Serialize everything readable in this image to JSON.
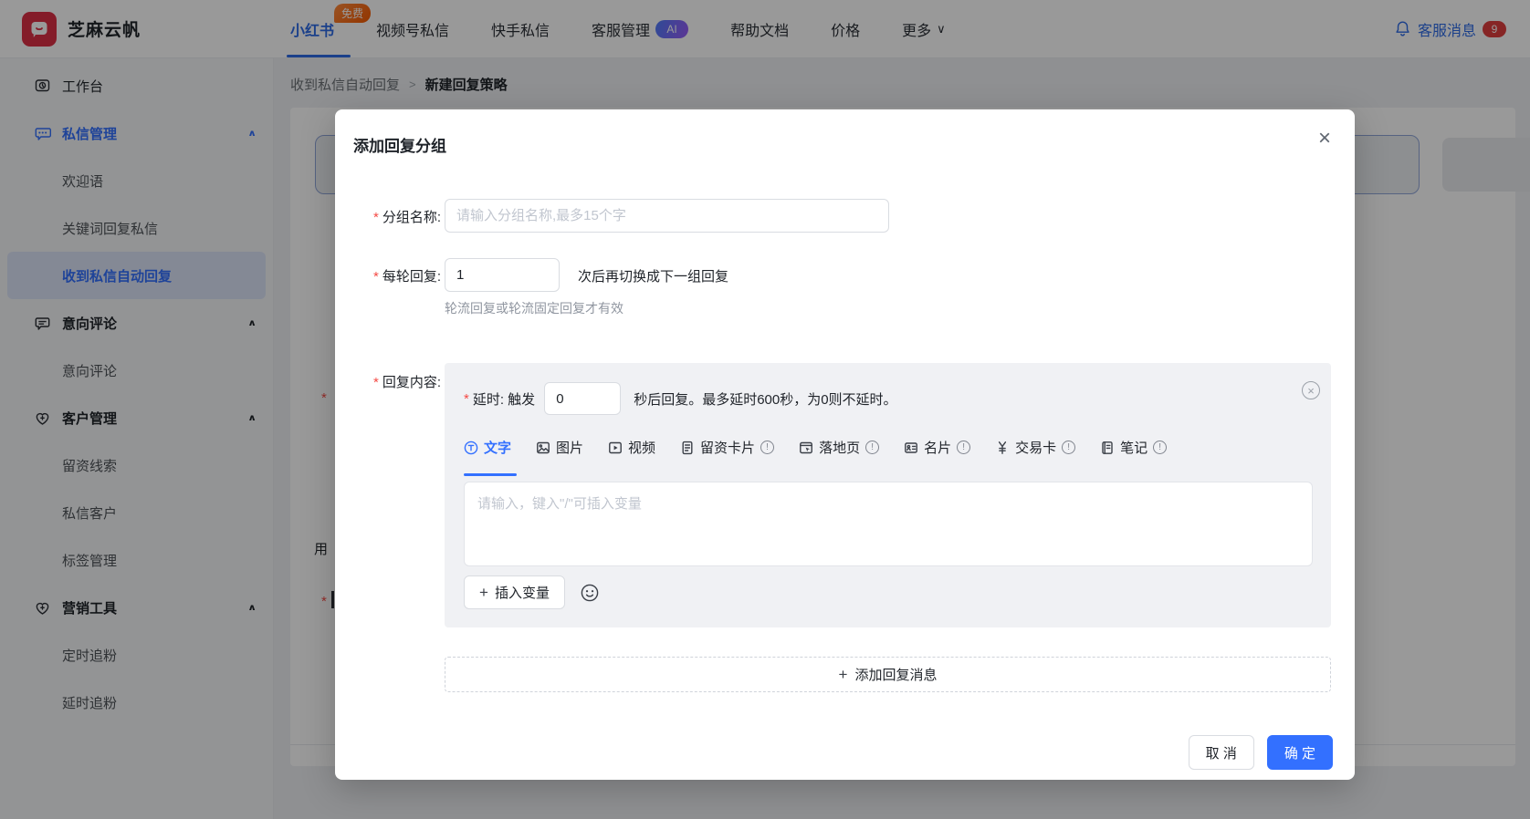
{
  "required_mark": "*",
  "colors": {
    "primary_blue": "#3370ff",
    "nav_active_blue": "#2e6be6",
    "logo_red": "#dd2f45",
    "badge_orange": "#f55a00",
    "badge_red": "#e03e3e",
    "ai_gradient": "#4f7dfc → #9a5bf7",
    "selected_item_bg": "#dde5f8",
    "card_gray": "#f0f1f4"
  },
  "navbar": {
    "brand": "芝麻云帆",
    "items": [
      {
        "label": "小红书",
        "badge": "免费",
        "active": true
      },
      {
        "label": "视频号私信"
      },
      {
        "label": "快手私信"
      },
      {
        "label": "客服管理",
        "badge": "AI"
      },
      {
        "label": "帮助文档"
      },
      {
        "label": "价格"
      },
      {
        "label": "更多",
        "chevron": "∨"
      }
    ],
    "messages": {
      "label": "客服消息",
      "count": "9"
    }
  },
  "breadcrumb": {
    "items": [
      "收到私信自动回复",
      "新建回复策略"
    ],
    "separator": ">"
  },
  "sidebar": {
    "items": [
      {
        "label": "工作台",
        "level": "top",
        "icon": "workbench-icon"
      },
      {
        "label": "私信管理",
        "level": "group",
        "icon": "chat-icon",
        "active": true,
        "chevron": "∧"
      },
      {
        "label": "欢迎语",
        "level": "sub"
      },
      {
        "label": "关键词回复私信",
        "level": "sub"
      },
      {
        "label": "收到私信自动回复",
        "level": "sub",
        "selected": true
      },
      {
        "label": "意向评论",
        "level": "group",
        "icon": "comment-icon",
        "chevron": "∧"
      },
      {
        "label": "意向评论",
        "level": "sub"
      },
      {
        "label": "客户管理",
        "level": "group",
        "icon": "customer-icon",
        "chevron": "∧"
      },
      {
        "label": "留资线索",
        "level": "sub"
      },
      {
        "label": "私信客户",
        "level": "sub"
      },
      {
        "label": "标签管理",
        "level": "sub"
      },
      {
        "label": "营销工具",
        "level": "group",
        "icon": "marketing-icon",
        "chevron": "∧"
      },
      {
        "label": "定时追粉",
        "level": "sub"
      },
      {
        "label": "延时追粉",
        "level": "sub"
      }
    ]
  },
  "background": {
    "remnant_char": "用",
    "asterisk": "*"
  },
  "modal": {
    "title": "添加回复分组",
    "close_icon": "×",
    "fields": {
      "group_name": {
        "label": "分组名称:",
        "placeholder": "请输入分组名称,最多15个字"
      },
      "per_round": {
        "label": "每轮回复:",
        "value": "1",
        "suffix": "次后再切换成下一组回复",
        "hint": "轮流回复或轮流固定回复才有效"
      },
      "reply_content": {
        "label": "回复内容:"
      }
    },
    "message_card": {
      "delay": {
        "label": "延时: 触发",
        "value": "0",
        "suffix": "秒后回复。最多延时600秒，为0则不延时。",
        "close_icon": "×"
      },
      "tabs": [
        {
          "label": "文字",
          "icon": "text-icon",
          "active": true
        },
        {
          "label": "图片",
          "icon": "image-icon"
        },
        {
          "label": "视频",
          "icon": "video-icon"
        },
        {
          "label": "留资卡片",
          "icon": "lead-card-icon",
          "info": "!"
        },
        {
          "label": "落地页",
          "icon": "landing-page-icon",
          "info": "!"
        },
        {
          "label": "名片",
          "icon": "business-card-icon",
          "info": "!"
        },
        {
          "label": "交易卡",
          "icon": "trade-card-icon",
          "info": "!"
        },
        {
          "label": "笔记",
          "icon": "note-icon",
          "info": "!"
        }
      ],
      "editor_placeholder": "请输入，键入\"/\"可插入变量",
      "insert_variable": {
        "plus": "+",
        "label": "插入变量"
      }
    },
    "add_reply": {
      "plus": "+",
      "label": "添加回复消息"
    },
    "footer": {
      "cancel": "取 消",
      "confirm": "确 定"
    }
  }
}
